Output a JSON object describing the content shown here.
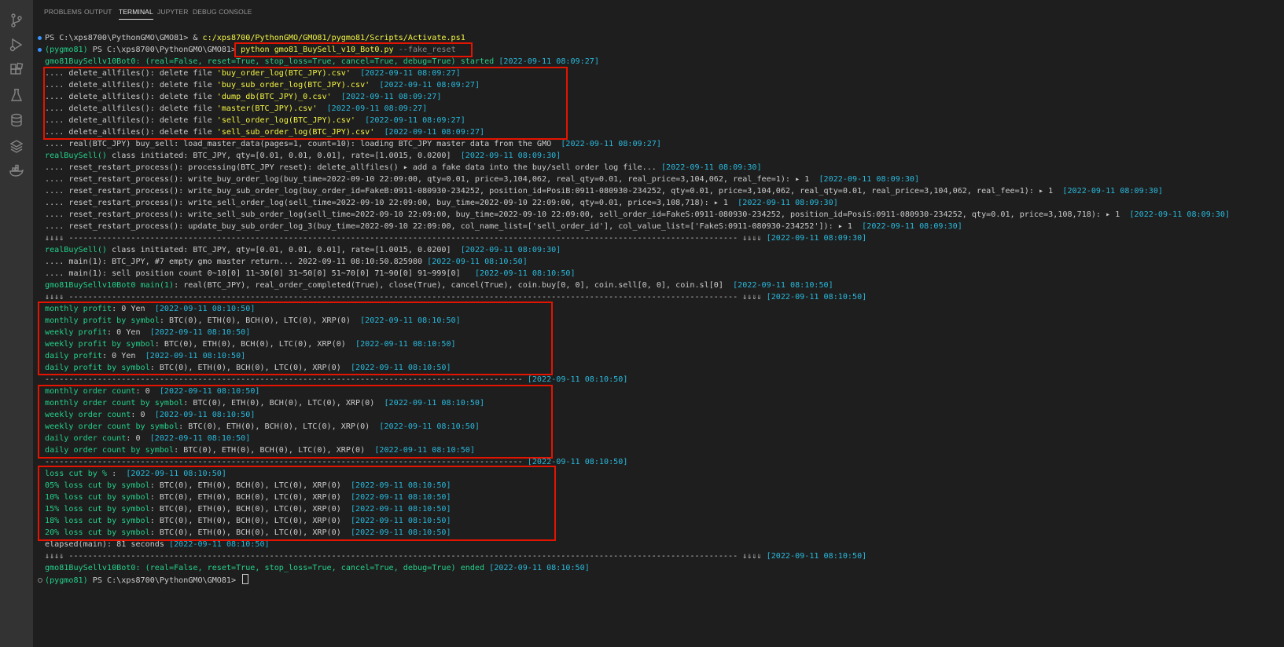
{
  "panel": {
    "tabs": [
      "PROBLEMS",
      "OUTPUT",
      "TERMINAL",
      "JUPYTER",
      "DEBUG CONSOLE"
    ],
    "active_tab": "TERMINAL"
  },
  "activity_bar": {
    "icons": [
      "source-control-icon",
      "run-debug-icon",
      "extensions-icon",
      "testing-icon",
      "database-icon",
      "layers-icon",
      "docker-icon"
    ]
  },
  "colors": {
    "prompt_green": "#23d18b",
    "command_yellow": "#f5f543",
    "timestamp_cyan": "#29b8db",
    "text": "#cccccc",
    "highlight_red": "#e51400"
  },
  "terminal": {
    "lines": [
      {
        "dot": "blue",
        "segs": [
          [
            "w",
            "PS C:\\xps8700\\PythonGMO\\GMO81> & "
          ],
          [
            "y",
            "c:/xps8700/PythonGMO/GMO81/pygmo81/Scripts/Activate.ps1"
          ]
        ]
      },
      {
        "dot": "blue",
        "segs": [
          [
            "g",
            "(pygmo81) "
          ],
          [
            "w",
            "PS C:\\xps8700\\PythonGMO\\GMO81> "
          ],
          [
            "y",
            "python gmo81_BuySell_v10_Bot0.py "
          ],
          [
            "d",
            "--fake_reset"
          ]
        ]
      },
      {
        "segs": [
          [
            "g",
            "gmo81BuySellv10Bot0: (real=False, reset=True, stop_loss=True, cancel=True, debug=True) started "
          ],
          [
            "b",
            "[2022-09-11 08:09:27]"
          ]
        ]
      },
      {
        "segs": [
          [
            "w",
            ".... delete_allfiles(): delete file "
          ],
          [
            "y",
            "'buy_order_log(BTC_JPY).csv'"
          ],
          [
            "w",
            "  "
          ],
          [
            "b",
            "[2022-09-11 08:09:27]"
          ]
        ]
      },
      {
        "segs": [
          [
            "w",
            ".... delete_allfiles(): delete file "
          ],
          [
            "y",
            "'buy_sub_order_log(BTC_JPY).csv'"
          ],
          [
            "w",
            "  "
          ],
          [
            "b",
            "[2022-09-11 08:09:27]"
          ]
        ]
      },
      {
        "segs": [
          [
            "w",
            ".... delete_allfiles(): delete file "
          ],
          [
            "y",
            "'dump_db(BTC_JPY)_0.csv'"
          ],
          [
            "w",
            "  "
          ],
          [
            "b",
            "[2022-09-11 08:09:27]"
          ]
        ]
      },
      {
        "segs": [
          [
            "w",
            ".... delete_allfiles(): delete file "
          ],
          [
            "y",
            "'master(BTC_JPY).csv'"
          ],
          [
            "w",
            "  "
          ],
          [
            "b",
            "[2022-09-11 08:09:27]"
          ]
        ]
      },
      {
        "segs": [
          [
            "w",
            ".... delete_allfiles(): delete file "
          ],
          [
            "y",
            "'sell_order_log(BTC_JPY).csv'"
          ],
          [
            "w",
            "  "
          ],
          [
            "b",
            "[2022-09-11 08:09:27]"
          ]
        ]
      },
      {
        "segs": [
          [
            "w",
            ".... delete_allfiles(): delete file "
          ],
          [
            "y",
            "'sell_sub_order_log(BTC_JPY).csv'"
          ],
          [
            "w",
            "  "
          ],
          [
            "b",
            "[2022-09-11 08:09:27]"
          ]
        ]
      },
      {
        "segs": [
          [
            "w",
            ".... real(BTC_JPY) buy_sell: load_master_data(pages=1, count=10): loading BTC_JPY master data from the GMO  "
          ],
          [
            "b",
            "[2022-09-11 08:09:27]"
          ]
        ]
      },
      {
        "segs": [
          [
            "g",
            "realBuySell()"
          ],
          [
            "w",
            " class initiated: BTC_JPY, qty=[0.01, 0.01, 0.01], rate=[1.0015, 0.0200]  "
          ],
          [
            "b",
            "[2022-09-11 08:09:30]"
          ]
        ]
      },
      {
        "segs": [
          [
            "w",
            ".... reset_restart_process(): processing(BTC_JPY reset): delete_allfiles() ▸ add a fake data into the buy/sell order log file... "
          ],
          [
            "b",
            "[2022-09-11 08:09:30]"
          ]
        ]
      },
      {
        "segs": [
          [
            "w",
            ".... reset_restart_process(): write_buy_order_log(buy_time=2022-09-10 22:09:00, qty=0.01, price=3,104,062, real_qty=0.01, real_price=3,104,062, real_fee=1): ▸ 1  "
          ],
          [
            "b",
            "[2022-09-11 08:09:30]"
          ]
        ]
      },
      {
        "segs": [
          [
            "w",
            ".... reset_restart_process(): write_buy_sub_order_log(buy_order_id=FakeB:0911-080930-234252, position_id=PosiB:0911-080930-234252, qty=0.01, price=3,104,062, real_qty=0.01, real_price=3,104,062, real_fee=1): ▸ 1  "
          ],
          [
            "b",
            "[2022-09-11 08:09:30]"
          ]
        ]
      },
      {
        "segs": [
          [
            "w",
            ".... reset_restart_process(): write_sell_order_log(sell_time=2022-09-10 22:09:00, buy_time=2022-09-10 22:09:00, qty=0.01, price=3,108,718): ▸ 1  "
          ],
          [
            "b",
            "[2022-09-11 08:09:30]"
          ]
        ]
      },
      {
        "segs": [
          [
            "w",
            ".... reset_restart_process(): write_sell_sub_order_log(sell_time=2022-09-10 22:09:00, buy_time=2022-09-10 22:09:00, sell_order_id=FakeS:0911-080930-234252, position_id=PosiS:0911-080930-234252, qty=0.01, price=3,108,718): ▸ 1  "
          ],
          [
            "b",
            "[2022-09-11 08:09:30]"
          ]
        ]
      },
      {
        "segs": [
          [
            "w",
            ".... reset_restart_process(): update_buy_sub_order_log_3(buy_time=2022-09-10 22:09:00, col_name_list=['sell_order_id'], col_value_list=['FakeS:0911-080930-234252']): ▸ 1  "
          ],
          [
            "b",
            "[2022-09-11 08:09:30]"
          ]
        ]
      },
      {
        "segs": [
          [
            "w",
            "⇓⇓⇓⇓ -------------------------------------------------------------------------------------------------------------------------------------------- ⇓⇓⇓⇓ "
          ],
          [
            "b",
            "[2022-09-11 08:09:30]"
          ]
        ]
      },
      {
        "segs": [
          [
            "g",
            "realBuySell()"
          ],
          [
            "w",
            " class initiated: BTC_JPY, qty=[0.01, 0.01, 0.01], rate=[1.0015, 0.0200]  "
          ],
          [
            "b",
            "[2022-09-11 08:09:30]"
          ]
        ]
      },
      {
        "segs": [
          [
            "w",
            ".... main(1): BTC_JPY, #7 empty gmo master return... 2022-09-11 08:10:50.825980 "
          ],
          [
            "b",
            "[2022-09-11 08:10:50]"
          ]
        ]
      },
      {
        "segs": [
          [
            "w",
            ".... main(1): sell position count 0~10[0] 11~30[0] 31~50[0] 51~70[0] 71~90[0] 91~999[0]   "
          ],
          [
            "b",
            "[2022-09-11 08:10:50]"
          ]
        ]
      },
      {
        "segs": [
          [
            "g",
            "gmo81BuySellv10Bot0 main(1)"
          ],
          [
            "w",
            ": real(BTC_JPY), real_order_completed(True), close(True), cancel(True), coin.buy[0, 0], coin.sell[0, 0], coin.sl[0]  "
          ],
          [
            "b",
            "[2022-09-11 08:10:50]"
          ]
        ]
      },
      {
        "segs": [
          [
            "w",
            "⇓⇓⇓⇓ -------------------------------------------------------------------------------------------------------------------------------------------- ⇓⇓⇓⇓ "
          ],
          [
            "b",
            "[2022-09-11 08:10:50]"
          ]
        ]
      },
      {
        "segs": [
          [
            "g",
            "monthly profit"
          ],
          [
            "w",
            ": 0 Yen  "
          ],
          [
            "b",
            "[2022-09-11 08:10:50]"
          ]
        ]
      },
      {
        "segs": [
          [
            "g",
            "monthly profit by symbol"
          ],
          [
            "w",
            ": BTC(0), ETH(0), BCH(0), LTC(0), XRP(0)  "
          ],
          [
            "b",
            "[2022-09-11 08:10:50]"
          ]
        ]
      },
      {
        "segs": [
          [
            "g",
            "weekly profit"
          ],
          [
            "w",
            ": 0 Yen  "
          ],
          [
            "b",
            "[2022-09-11 08:10:50]"
          ]
        ]
      },
      {
        "segs": [
          [
            "g",
            "weekly profit by symbol"
          ],
          [
            "w",
            ": BTC(0), ETH(0), BCH(0), LTC(0), XRP(0)  "
          ],
          [
            "b",
            "[2022-09-11 08:10:50]"
          ]
        ]
      },
      {
        "segs": [
          [
            "g",
            "daily profit"
          ],
          [
            "w",
            ": 0 Yen  "
          ],
          [
            "b",
            "[2022-09-11 08:10:50]"
          ]
        ]
      },
      {
        "segs": [
          [
            "g",
            "daily profit by symbol"
          ],
          [
            "w",
            ": BTC(0), ETH(0), BCH(0), LTC(0), XRP(0)  "
          ],
          [
            "b",
            "[2022-09-11 08:10:50]"
          ]
        ]
      },
      {
        "segs": [
          [
            "w",
            "---------------------------------------------------------------------------------------------------- "
          ],
          [
            "b",
            "[2022-09-11 08:10:50]"
          ]
        ]
      },
      {
        "segs": [
          [
            "g",
            "monthly order count"
          ],
          [
            "w",
            ": 0  "
          ],
          [
            "b",
            "[2022-09-11 08:10:50]"
          ]
        ]
      },
      {
        "segs": [
          [
            "g",
            "monthly order count by symbol"
          ],
          [
            "w",
            ": BTC(0), ETH(0), BCH(0), LTC(0), XRP(0)  "
          ],
          [
            "b",
            "[2022-09-11 08:10:50]"
          ]
        ]
      },
      {
        "segs": [
          [
            "g",
            "weekly order count"
          ],
          [
            "w",
            ": 0  "
          ],
          [
            "b",
            "[2022-09-11 08:10:50]"
          ]
        ]
      },
      {
        "segs": [
          [
            "g",
            "weekly order count by symbol"
          ],
          [
            "w",
            ": BTC(0), ETH(0), BCH(0), LTC(0), XRP(0)  "
          ],
          [
            "b",
            "[2022-09-11 08:10:50]"
          ]
        ]
      },
      {
        "segs": [
          [
            "g",
            "daily order count"
          ],
          [
            "w",
            ": 0  "
          ],
          [
            "b",
            "[2022-09-11 08:10:50]"
          ]
        ]
      },
      {
        "segs": [
          [
            "g",
            "daily order count by symbol"
          ],
          [
            "w",
            ": BTC(0), ETH(0), BCH(0), LTC(0), XRP(0)  "
          ],
          [
            "b",
            "[2022-09-11 08:10:50]"
          ]
        ]
      },
      {
        "segs": [
          [
            "w",
            "---------------------------------------------------------------------------------------------------- "
          ],
          [
            "b",
            "[2022-09-11 08:10:50]"
          ]
        ]
      },
      {
        "segs": [
          [
            "g",
            "loss cut by %"
          ],
          [
            "w",
            " :  "
          ],
          [
            "b",
            "[2022-09-11 08:10:50]"
          ]
        ]
      },
      {
        "segs": [
          [
            "g",
            "05% loss cut by symbol"
          ],
          [
            "w",
            ": BTC(0), ETH(0), BCH(0), LTC(0), XRP(0)  "
          ],
          [
            "b",
            "[2022-09-11 08:10:50]"
          ]
        ]
      },
      {
        "segs": [
          [
            "g",
            "10% loss cut by symbol"
          ],
          [
            "w",
            ": BTC(0), ETH(0), BCH(0), LTC(0), XRP(0)  "
          ],
          [
            "b",
            "[2022-09-11 08:10:50]"
          ]
        ]
      },
      {
        "segs": [
          [
            "g",
            "15% loss cut by symbol"
          ],
          [
            "w",
            ": BTC(0), ETH(0), BCH(0), LTC(0), XRP(0)  "
          ],
          [
            "b",
            "[2022-09-11 08:10:50]"
          ]
        ]
      },
      {
        "segs": [
          [
            "g",
            "18% loss cut by symbol"
          ],
          [
            "w",
            ": BTC(0), ETH(0), BCH(0), LTC(0), XRP(0)  "
          ],
          [
            "b",
            "[2022-09-11 08:10:50]"
          ]
        ]
      },
      {
        "segs": [
          [
            "g",
            "20% loss cut by symbol"
          ],
          [
            "w",
            ": BTC(0), ETH(0), BCH(0), LTC(0), XRP(0)  "
          ],
          [
            "b",
            "[2022-09-11 08:10:50]"
          ]
        ]
      },
      {
        "segs": [
          [
            "w",
            "elapsed(main): 81 seconds "
          ],
          [
            "b",
            "[2022-09-11 08:10:50]"
          ]
        ]
      },
      {
        "segs": [
          [
            "w",
            "⇓⇓⇓⇓ -------------------------------------------------------------------------------------------------------------------------------------------- ⇓⇓⇓⇓ "
          ],
          [
            "b",
            "[2022-09-11 08:10:50]"
          ]
        ]
      },
      {
        "segs": [
          [
            "g",
            "gmo81BuySellv10Bot0: (real=False, reset=True, stop_loss=True, cancel=True, debug=True) ended "
          ],
          [
            "b",
            "[2022-09-11 08:10:50]"
          ]
        ]
      },
      {
        "dot": "hollow",
        "cursor": true,
        "segs": [
          [
            "g",
            "(pygmo81) "
          ],
          [
            "w",
            "PS C:\\xps8700\\PythonGMO\\GMO81> "
          ]
        ]
      }
    ]
  }
}
